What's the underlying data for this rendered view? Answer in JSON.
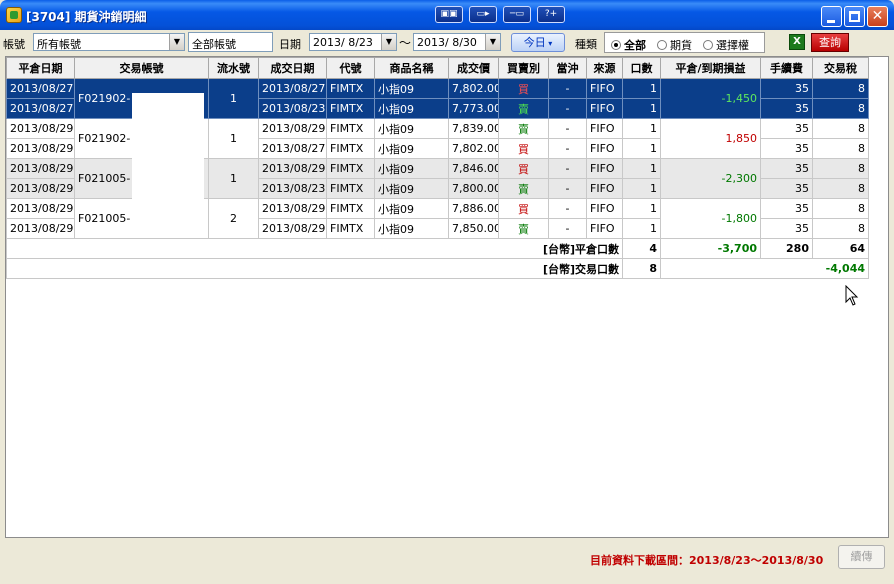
{
  "window": {
    "title": "[3704] 期貨沖銷明細",
    "toolbar_icons": [
      "layout-icon",
      "export-icon",
      "link-icon",
      "help-icon"
    ],
    "help_label": "?+"
  },
  "filters": {
    "account_label": "帳號",
    "account_value": "所有帳號",
    "account_name": "全部帳號",
    "date_label": "日期",
    "date_from": "2013/ 8/23",
    "date_sep": "～",
    "date_to": "2013/ 8/30",
    "today_button": "今日",
    "type_label": "種類",
    "radio_all": "全部",
    "radio_futures": "期貨",
    "radio_options": "選擇權",
    "excel_label": "X",
    "query_button": "查詢"
  },
  "table": {
    "headers": [
      "平倉日期",
      "交易帳號",
      "流水號",
      "成交日期",
      "代號",
      "商品名稱",
      "成交價",
      "買賣別",
      "當沖",
      "來源",
      "口數",
      "平倉/到期損益",
      "手續費",
      "交易稅"
    ],
    "groups": [
      {
        "account": "F021902-",
        "serial": "1",
        "pnl": "-1,450",
        "style": "sel",
        "rows": [
          {
            "close_date": "2013/08/27",
            "trade_date": "2013/08/27",
            "code": "FIMTX",
            "name": "小指09",
            "price": "7,802.00",
            "side": "買",
            "daytrade": "-",
            "source": "FIFO",
            "qty": "1",
            "fee": "35",
            "tax": "8"
          },
          {
            "close_date": "2013/08/27",
            "trade_date": "2013/08/23",
            "code": "FIMTX",
            "name": "小指09",
            "price": "7,773.00",
            "side": "賣",
            "daytrade": "-",
            "source": "FIFO",
            "qty": "1",
            "fee": "35",
            "tax": "8"
          }
        ]
      },
      {
        "account": "F021902-",
        "serial": "1",
        "pnl": "1,850",
        "style": "white",
        "rows": [
          {
            "close_date": "2013/08/29",
            "trade_date": "2013/08/29",
            "code": "FIMTX",
            "name": "小指09",
            "price": "7,839.00",
            "side": "賣",
            "daytrade": "-",
            "source": "FIFO",
            "qty": "1",
            "fee": "35",
            "tax": "8"
          },
          {
            "close_date": "2013/08/29",
            "trade_date": "2013/08/27",
            "code": "FIMTX",
            "name": "小指09",
            "price": "7,802.00",
            "side": "買",
            "daytrade": "-",
            "source": "FIFO",
            "qty": "1",
            "fee": "35",
            "tax": "8"
          }
        ]
      },
      {
        "account": "F021005-",
        "serial": "1",
        "pnl": "-2,300",
        "style": "grey",
        "rows": [
          {
            "close_date": "2013/08/29",
            "trade_date": "2013/08/29",
            "code": "FIMTX",
            "name": "小指09",
            "price": "7,846.00",
            "side": "買",
            "daytrade": "-",
            "source": "FIFO",
            "qty": "1",
            "fee": "35",
            "tax": "8"
          },
          {
            "close_date": "2013/08/29",
            "trade_date": "2013/08/23",
            "code": "FIMTX",
            "name": "小指09",
            "price": "7,800.00",
            "side": "賣",
            "daytrade": "-",
            "source": "FIFO",
            "qty": "1",
            "fee": "35",
            "tax": "8"
          }
        ]
      },
      {
        "account": "F021005-",
        "serial": "2",
        "pnl": "-1,800",
        "style": "white",
        "rows": [
          {
            "close_date": "2013/08/29",
            "trade_date": "2013/08/29",
            "code": "FIMTX",
            "name": "小指09",
            "price": "7,886.00",
            "side": "買",
            "daytrade": "-",
            "source": "FIFO",
            "qty": "1",
            "fee": "35",
            "tax": "8"
          },
          {
            "close_date": "2013/08/29",
            "trade_date": "2013/08/29",
            "code": "FIMTX",
            "name": "小指09",
            "price": "7,850.00",
            "side": "賣",
            "daytrade": "-",
            "source": "FIFO",
            "qty": "1",
            "fee": "35",
            "tax": "8"
          }
        ]
      }
    ],
    "summary_close": {
      "label": "[台幣]平倉口數",
      "qty": "4",
      "pnl": "-3,700",
      "fee": "280",
      "tax": "64"
    },
    "summary_trade": {
      "label": "[台幣]交易口數",
      "qty": "8",
      "total": "-4,044"
    }
  },
  "status": {
    "range_text": "目前資料下載區間：2013/8/23～2013/8/30",
    "continue_button": "續傳"
  }
}
